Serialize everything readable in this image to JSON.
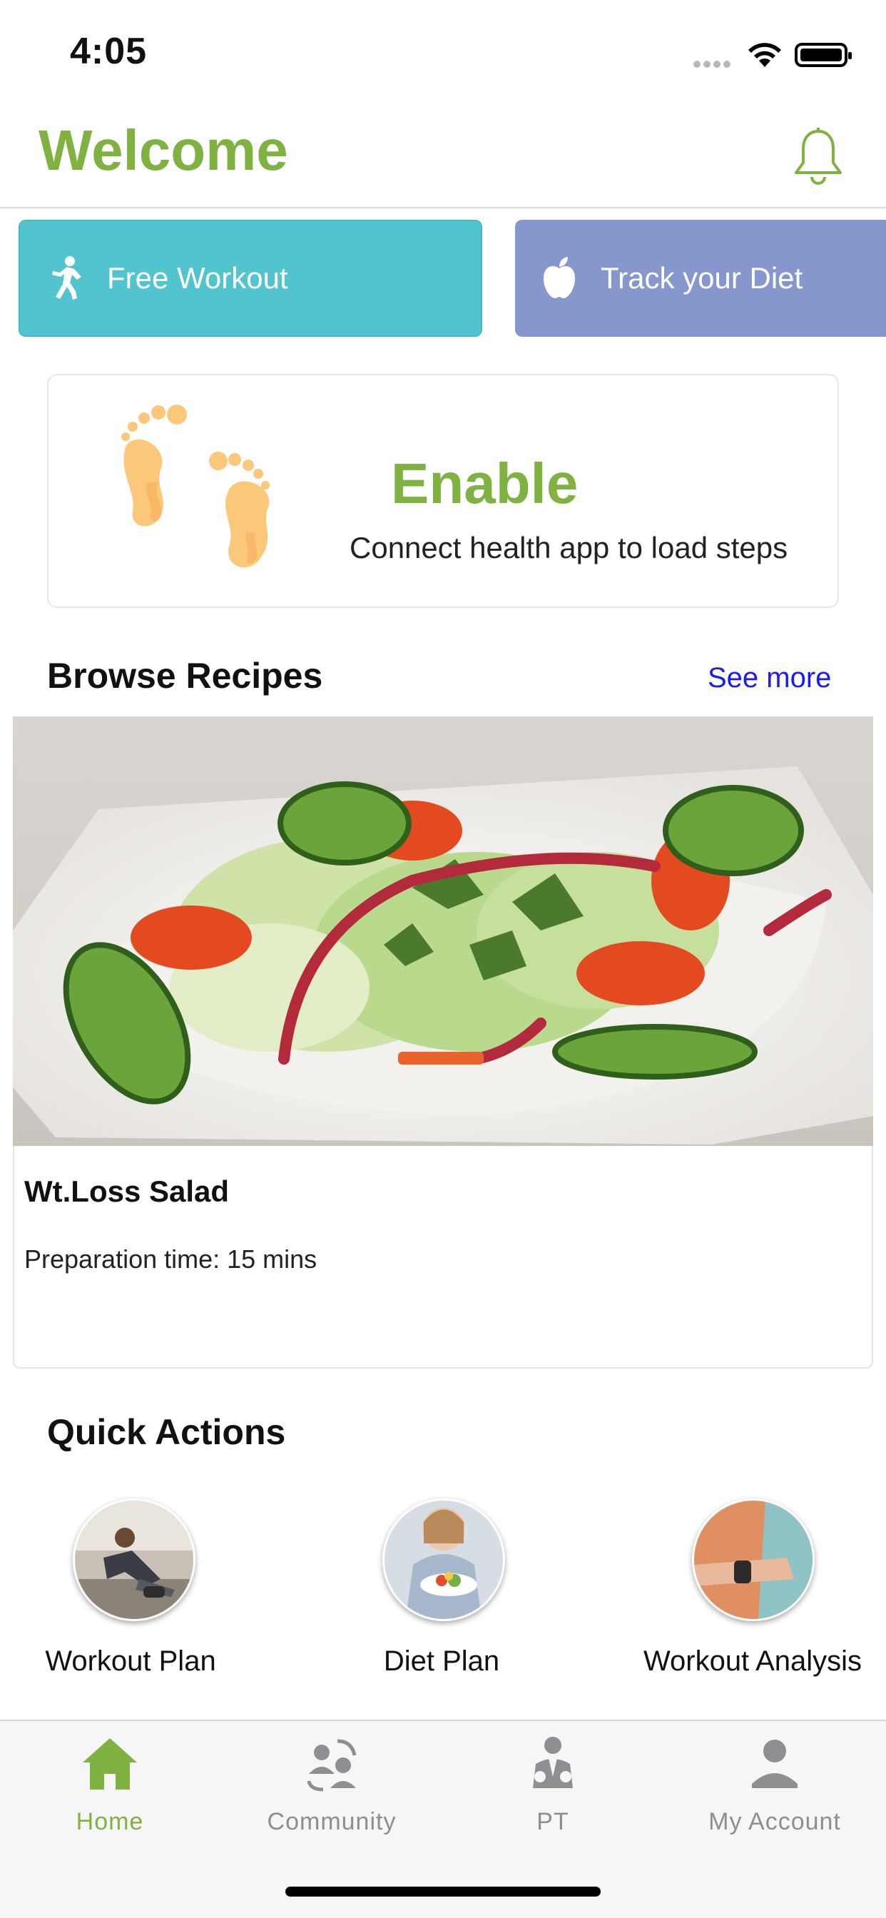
{
  "status_bar": {
    "time": "4:05"
  },
  "header": {
    "title": "Welcome",
    "bell_icon": "bell-icon"
  },
  "top_actions": [
    {
      "label": "Free Workout",
      "icon": "walking-person-icon",
      "color": "#52c4cd"
    },
    {
      "label": "Track your Diet",
      "icon": "apple-icon",
      "color": "#8597cc"
    }
  ],
  "steps_card": {
    "icon": "footprints-icon",
    "title": "Enable",
    "subtitle": "Connect health app to load steps"
  },
  "recipes": {
    "section_title": "Browse Recipes",
    "see_more": "See more",
    "featured": {
      "name": "Wt.Loss Salad",
      "prep_time": "Preparation time: 15 mins",
      "image": "salad-photo"
    }
  },
  "quick_actions": {
    "section_title": "Quick Actions",
    "items": [
      {
        "label": "Workout Plan",
        "image": "workout-photo"
      },
      {
        "label": "Diet Plan",
        "image": "diet-photo"
      },
      {
        "label": "Workout Analysis",
        "image": "analysis-photo"
      }
    ]
  },
  "tab_bar": {
    "tabs": [
      {
        "label": "Home",
        "icon": "home-icon",
        "active": true
      },
      {
        "label": "Community",
        "icon": "community-icon",
        "active": false
      },
      {
        "label": "PT",
        "icon": "trainer-icon",
        "active": false
      },
      {
        "label": "My Account",
        "icon": "account-icon",
        "active": false
      }
    ]
  },
  "colors": {
    "accent_green": "#7fb241",
    "link_blue": "#1a1aff",
    "inactive_gray": "#8e8e93"
  }
}
